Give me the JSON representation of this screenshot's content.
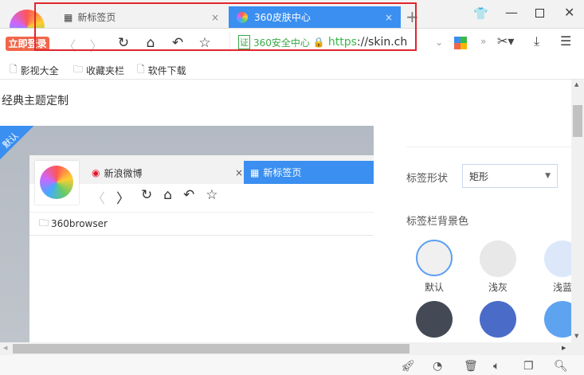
{
  "tabs": [
    {
      "label": "新标签页",
      "icon": "grid-icon",
      "active": false
    },
    {
      "label": "360皮肤中心",
      "icon": "skin-logo-icon",
      "active": true
    }
  ],
  "login_badge": "立即登录",
  "address": {
    "cert": "证",
    "site": "360安全中心",
    "url_scheme": "https",
    "url_rest": "://skin.ch"
  },
  "bookmarks": [
    {
      "label": "影视大全",
      "icon": "page-icon"
    },
    {
      "label": "收藏夹栏",
      "icon": "folder-icon"
    },
    {
      "label": "软件下载",
      "icon": "page-icon"
    }
  ],
  "page": {
    "title": "经典主题定制",
    "badge": "默认"
  },
  "preview": {
    "tabs": [
      {
        "label": "新浪微博"
      },
      {
        "label": "新标签页"
      }
    ],
    "bookmark": "360browser"
  },
  "settings": {
    "shape_label": "标签形状",
    "shape_value": "矩形",
    "bg_label": "标签栏背景色",
    "colors": [
      {
        "label": "默认",
        "color": "#f0f0f0",
        "selected": true
      },
      {
        "label": "浅灰",
        "color": "#e8e8e8"
      },
      {
        "label": "浅蓝",
        "color": "#dce8fa"
      },
      {
        "label": "",
        "color": "#434a56"
      },
      {
        "label": "",
        "color": "#4a6cc8"
      },
      {
        "label": "",
        "color": "#5ea3f0"
      }
    ]
  },
  "colors": {
    "accent": "#3a8ff0",
    "highlight": "#e0262d"
  }
}
